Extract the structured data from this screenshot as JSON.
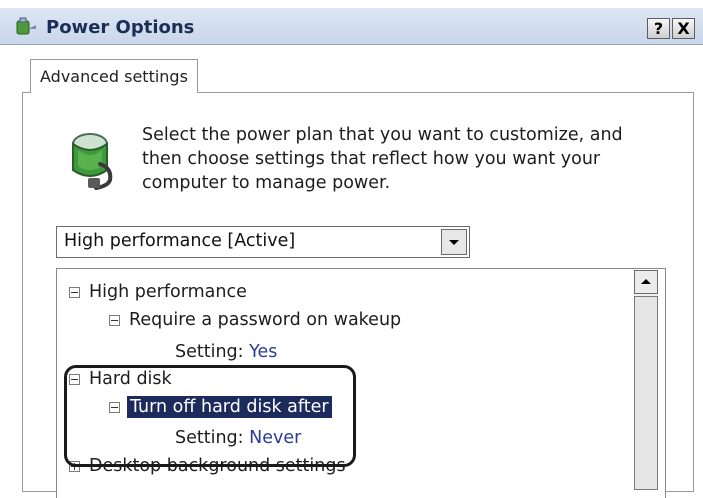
{
  "window": {
    "title": "Power Options",
    "help_button": "?",
    "close_button": "X"
  },
  "tabs": [
    {
      "label": "Advanced settings",
      "active": true
    }
  ],
  "intro": {
    "text": "Select the power plan that you want to customize, and then choose settings that reflect how you want your computer to manage power.",
    "icon": "battery-plug-icon"
  },
  "plan_select": {
    "value": "High performance [Active]"
  },
  "tree": {
    "items": [
      {
        "label": "High performance",
        "expander": "minus"
      },
      {
        "label": "Require a password on wakeup",
        "expander": "minus"
      },
      {
        "setting_label": "Setting:",
        "setting_value": "Yes"
      },
      {
        "label": "Hard disk",
        "expander": "minus"
      },
      {
        "label": "Turn off hard disk after",
        "expander": "minus",
        "selected": true
      },
      {
        "setting_label": "Setting:",
        "setting_value": "Never"
      },
      {
        "label": "Desktop background settings",
        "expander": "plus"
      }
    ]
  },
  "colors": {
    "title_text": "#1b2f55",
    "selection_bg": "#1d2a5c",
    "setting_value": "#2a3c96",
    "highlight_outline": "#1a1a1a"
  }
}
